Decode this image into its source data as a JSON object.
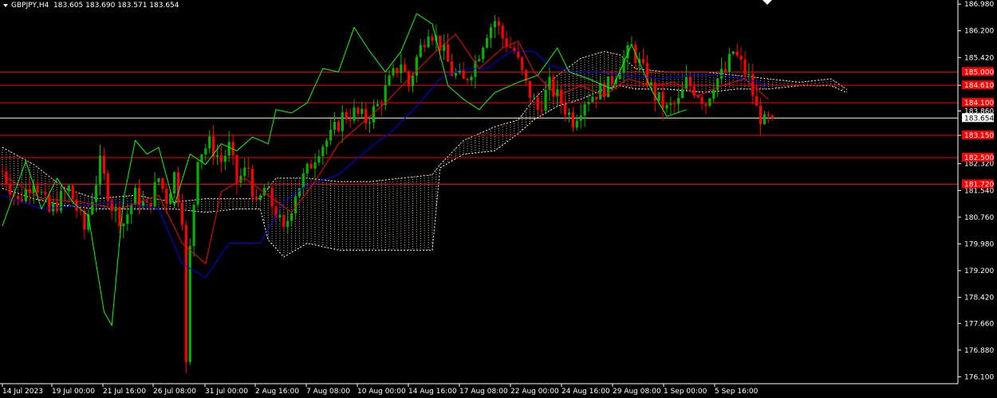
{
  "header": {
    "symbol": "GBPJPY,H4",
    "quote": "183.605 183.690 183.571 183.654"
  },
  "colors": {
    "background": "#000000",
    "axis": "#ffffff",
    "level_line": "#ff0000",
    "level_label_bg": "#ff0000",
    "current_price_line": "#ffffc8",
    "bull_candle": "#00b400",
    "bear_candle": "#ff0000",
    "tenkan": "#ff0000",
    "kijun": "#0000ff",
    "chikou": "#00ff00",
    "cloud": "#f5deb3"
  },
  "chart_data": {
    "type": "candlestick",
    "symbol": "GBPJPY",
    "timeframe": "H4",
    "ylim": [
      175.9,
      187.1
    ],
    "y_ticks": [
      "186.980",
      "186.200",
      "185.420",
      "184.610",
      "183.860",
      "183.150",
      "182.320",
      "181.540",
      "180.760",
      "179.980",
      "179.200",
      "178.420",
      "177.660",
      "176.880",
      "176.100"
    ],
    "x_ticks": [
      "14 Jul 2023",
      "19 Jul 00:00",
      "21 Jul 16:00",
      "26 Jul 08:00",
      "31 Jul 00:00",
      "2 Aug 16:00",
      "7 Aug 08:00",
      "10 Aug 00:00",
      "14 Aug 16:00",
      "17 Aug 08:00",
      "22 Aug 00:00",
      "24 Aug 16:00",
      "29 Aug 08:00",
      "1 Sep 00:00",
      "5 Sep 16:00"
    ],
    "current_price": {
      "value": 183.654,
      "label": "183.654"
    },
    "levels": [
      {
        "value": 185.0,
        "label": "185.000"
      },
      {
        "value": 184.61,
        "label": "184.610"
      },
      {
        "value": 184.1,
        "label": "184.100"
      },
      {
        "value": 183.15,
        "label": "183.150"
      },
      {
        "value": 182.5,
        "label": "182.500"
      },
      {
        "value": 181.72,
        "label": "181.720"
      }
    ],
    "price_path": [
      [
        0,
        182.1
      ],
      [
        4,
        181.2
      ],
      [
        8,
        181.9
      ],
      [
        12,
        180.9
      ],
      [
        17,
        181.6
      ],
      [
        21,
        180.4
      ],
      [
        25,
        182.3
      ],
      [
        28,
        181.1
      ],
      [
        31,
        180.6
      ],
      [
        34,
        181.4
      ],
      [
        37,
        181.0
      ],
      [
        40,
        181.9
      ],
      [
        42,
        181.3
      ],
      [
        44,
        182.0
      ],
      [
        46,
        180.8
      ],
      [
        47,
        176.4
      ],
      [
        48,
        179.8
      ],
      [
        50,
        182.6
      ],
      [
        53,
        182.9
      ],
      [
        56,
        182.4
      ],
      [
        58,
        182.8
      ],
      [
        60,
        181.8
      ],
      [
        63,
        182.2
      ],
      [
        65,
        181.0
      ],
      [
        67,
        181.6
      ],
      [
        70,
        180.9
      ],
      [
        72,
        180.3
      ],
      [
        75,
        181.5
      ],
      [
        78,
        182.1
      ],
      [
        81,
        182.8
      ],
      [
        84,
        183.1
      ],
      [
        87,
        183.7
      ],
      [
        90,
        183.8
      ],
      [
        93,
        183.6
      ],
      [
        96,
        184.0
      ],
      [
        99,
        184.7
      ],
      [
        102,
        185.3
      ],
      [
        104,
        184.6
      ],
      [
        106,
        185.4
      ],
      [
        109,
        186.3
      ],
      [
        112,
        185.8
      ],
      [
        115,
        185.0
      ],
      [
        118,
        184.7
      ],
      [
        121,
        185.3
      ],
      [
        124,
        186.2
      ],
      [
        126,
        186.5
      ],
      [
        128,
        186.0
      ],
      [
        131,
        185.6
      ],
      [
        134,
        184.6
      ],
      [
        137,
        183.9
      ],
      [
        140,
        184.6
      ],
      [
        143,
        184.1
      ],
      [
        146,
        183.6
      ],
      [
        149,
        184.2
      ],
      [
        152,
        184.4
      ],
      [
        155,
        184.6
      ],
      [
        158,
        185.2
      ],
      [
        161,
        185.7
      ],
      [
        164,
        185.0
      ],
      [
        167,
        184.3
      ],
      [
        170,
        183.9
      ],
      [
        173,
        184.1
      ],
      [
        175,
        184.7
      ],
      [
        178,
        184.4
      ],
      [
        180,
        184.1
      ],
      [
        182,
        184.7
      ],
      [
        185,
        185.0
      ],
      [
        187,
        185.6
      ],
      [
        189,
        185.2
      ],
      [
        191,
        184.8
      ],
      [
        193,
        183.9
      ],
      [
        195,
        183.5
      ],
      [
        197,
        183.654
      ]
    ],
    "tenkan_path": [
      [
        0,
        182.0
      ],
      [
        10,
        181.3
      ],
      [
        20,
        181.2
      ],
      [
        30,
        181.0
      ],
      [
        40,
        181.4
      ],
      [
        46,
        180.0
      ],
      [
        52,
        179.4
      ],
      [
        56,
        181.5
      ],
      [
        62,
        181.9
      ],
      [
        68,
        181.4
      ],
      [
        74,
        180.9
      ],
      [
        80,
        181.8
      ],
      [
        86,
        182.9
      ],
      [
        92,
        183.5
      ],
      [
        98,
        184.1
      ],
      [
        104,
        184.8
      ],
      [
        110,
        185.5
      ],
      [
        116,
        186.1
      ],
      [
        122,
        185.1
      ],
      [
        128,
        185.7
      ],
      [
        132,
        185.9
      ],
      [
        136,
        185.0
      ],
      [
        142,
        184.3
      ],
      [
        148,
        184.6
      ],
      [
        154,
        184.3
      ],
      [
        160,
        184.8
      ],
      [
        166,
        184.6
      ],
      [
        172,
        184.7
      ],
      [
        178,
        184.3
      ],
      [
        184,
        184.6
      ],
      [
        190,
        184.8
      ],
      [
        196,
        184.2
      ]
    ],
    "kijun_path": [
      [
        0,
        181.4
      ],
      [
        10,
        181.0
      ],
      [
        20,
        181.1
      ],
      [
        30,
        181.2
      ],
      [
        40,
        181.0
      ],
      [
        46,
        179.4
      ],
      [
        52,
        179.0
      ],
      [
        58,
        180.0
      ],
      [
        66,
        180.0
      ],
      [
        72,
        181.2
      ],
      [
        78,
        181.7
      ],
      [
        86,
        182.0
      ],
      [
        92,
        182.6
      ],
      [
        100,
        183.3
      ],
      [
        106,
        184.0
      ],
      [
        112,
        184.8
      ],
      [
        118,
        185.1
      ],
      [
        124,
        185.1
      ],
      [
        130,
        185.6
      ],
      [
        136,
        185.6
      ],
      [
        140,
        185.2
      ],
      [
        146,
        185.0
      ],
      [
        152,
        185.0
      ],
      [
        160,
        184.9
      ],
      [
        168,
        184.8
      ],
      [
        176,
        184.9
      ],
      [
        184,
        184.9
      ],
      [
        190,
        184.8
      ],
      [
        196,
        184.6
      ]
    ],
    "chikou_path": [
      [
        0,
        180.5
      ],
      [
        6,
        182.4
      ],
      [
        10,
        181.0
      ],
      [
        14,
        181.9
      ],
      [
        18,
        181.2
      ],
      [
        22,
        180.8
      ],
      [
        26,
        178.0
      ],
      [
        28,
        177.6
      ],
      [
        31,
        181.3
      ],
      [
        34,
        183.0
      ],
      [
        37,
        182.6
      ],
      [
        40,
        182.8
      ],
      [
        44,
        181.1
      ],
      [
        48,
        182.6
      ],
      [
        52,
        182.3
      ],
      [
        56,
        182.9
      ],
      [
        60,
        182.7
      ],
      [
        64,
        183.1
      ],
      [
        68,
        182.9
      ],
      [
        70,
        183.9
      ],
      [
        74,
        183.8
      ],
      [
        78,
        184.1
      ],
      [
        82,
        185.1
      ],
      [
        86,
        185.0
      ],
      [
        90,
        186.3
      ],
      [
        94,
        185.6
      ],
      [
        98,
        185.0
      ],
      [
        102,
        185.6
      ],
      [
        106,
        186.7
      ],
      [
        110,
        186.4
      ],
      [
        114,
        184.6
      ],
      [
        118,
        184.2
      ],
      [
        122,
        183.9
      ],
      [
        126,
        184.4
      ],
      [
        132,
        184.7
      ],
      [
        137,
        184.9
      ],
      [
        142,
        185.7
      ],
      [
        145,
        185.0
      ],
      [
        150,
        184.8
      ],
      [
        156,
        184.5
      ],
      [
        161,
        185.8
      ],
      [
        166,
        184.5
      ],
      [
        170,
        183.7
      ],
      [
        175,
        183.9
      ]
    ],
    "cloud": {
      "start": 0,
      "top": [
        [
          0,
          182.8
        ],
        [
          8,
          182.3
        ],
        [
          16,
          181.6
        ],
        [
          24,
          181.3
        ],
        [
          34,
          181.4
        ],
        [
          44,
          181.2
        ],
        [
          52,
          181.3
        ],
        [
          60,
          181.3
        ],
        [
          66,
          181.3
        ],
        [
          70,
          181.9
        ],
        [
          78,
          181.9
        ],
        [
          86,
          181.8
        ],
        [
          94,
          181.8
        ],
        [
          102,
          181.9
        ],
        [
          110,
          182.0
        ],
        [
          112,
          182.3
        ],
        [
          118,
          183.0
        ],
        [
          126,
          183.4
        ],
        [
          132,
          183.6
        ],
        [
          136,
          184.2
        ],
        [
          142,
          184.9
        ],
        [
          148,
          185.4
        ],
        [
          154,
          185.6
        ],
        [
          158,
          185.5
        ],
        [
          162,
          185.1
        ],
        [
          170,
          185.0
        ],
        [
          180,
          185.0
        ],
        [
          188,
          184.9
        ],
        [
          196,
          184.8
        ],
        [
          204,
          184.7
        ],
        [
          212,
          184.8
        ],
        [
          216,
          184.5
        ]
      ],
      "bottom": [
        [
          0,
          181.6
        ],
        [
          8,
          181.3
        ],
        [
          16,
          181.1
        ],
        [
          24,
          181.0
        ],
        [
          34,
          181.0
        ],
        [
          44,
          181.0
        ],
        [
          52,
          180.9
        ],
        [
          60,
          181.0
        ],
        [
          66,
          181.0
        ],
        [
          68,
          180.1
        ],
        [
          72,
          179.6
        ],
        [
          78,
          180.0
        ],
        [
          86,
          179.8
        ],
        [
          94,
          179.8
        ],
        [
          102,
          179.8
        ],
        [
          110,
          179.8
        ],
        [
          112,
          182.2
        ],
        [
          118,
          182.6
        ],
        [
          126,
          182.7
        ],
        [
          132,
          183.2
        ],
        [
          136,
          183.6
        ],
        [
          142,
          184.0
        ],
        [
          148,
          184.2
        ],
        [
          154,
          184.5
        ],
        [
          158,
          184.6
        ],
        [
          162,
          184.5
        ],
        [
          170,
          184.5
        ],
        [
          180,
          184.4
        ],
        [
          188,
          184.5
        ],
        [
          196,
          184.5
        ],
        [
          204,
          184.6
        ],
        [
          212,
          184.6
        ],
        [
          216,
          184.4
        ]
      ]
    }
  }
}
